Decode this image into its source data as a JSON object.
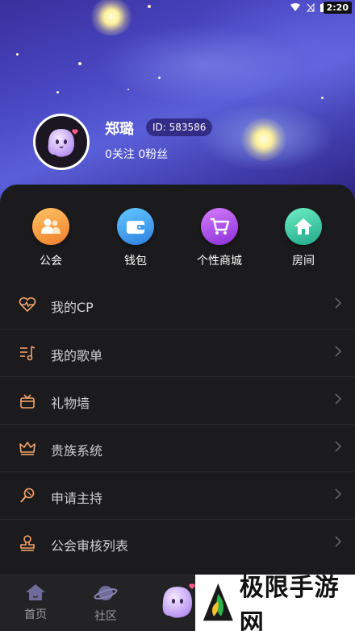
{
  "status_bar": {
    "time": "2:20"
  },
  "profile": {
    "username": "郑璐",
    "id_label": "ID: 583586",
    "follow_stats": "0关注 0粉丝"
  },
  "quick_actions": [
    {
      "label": "公会",
      "icon": "guild-icon",
      "color": "#f4a23c"
    },
    {
      "label": "钱包",
      "icon": "wallet-icon",
      "color": "#38a6e8"
    },
    {
      "label": "个性商城",
      "icon": "cart-icon",
      "color": "#b04ae2"
    },
    {
      "label": "房间",
      "icon": "house-icon",
      "color": "#2cc7a0"
    }
  ],
  "menu": [
    {
      "label": "我的CP",
      "icon": "heart-pulse-icon"
    },
    {
      "label": "我的歌单",
      "icon": "playlist-icon"
    },
    {
      "label": "礼物墙",
      "icon": "gift-box-icon"
    },
    {
      "label": "贵族系统",
      "icon": "crown-icon"
    },
    {
      "label": "申请主持",
      "icon": "microphone-icon"
    },
    {
      "label": "公会审核列表",
      "icon": "stamp-icon"
    }
  ],
  "tabbar": {
    "home": "首页",
    "community": "社区"
  },
  "watermark": {
    "text": "极限手游网"
  },
  "colors": {
    "accent_orange": "#f5a36b",
    "menu_text": "#cfcfd4",
    "panel_bg": "#1b1b1d"
  }
}
